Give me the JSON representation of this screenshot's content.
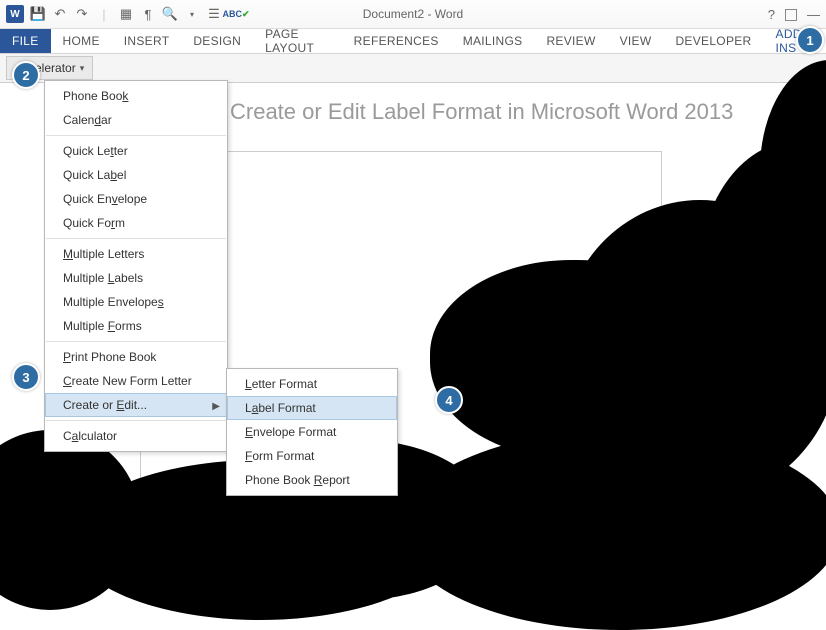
{
  "titlebar": {
    "app_icon_text": "W",
    "title": "Document2 - Word"
  },
  "tabs": {
    "file": "FILE",
    "home": "HOME",
    "insert": "INSERT",
    "design": "DESIGN",
    "page_layout": "PAGE LAYOUT",
    "references": "REFERENCES",
    "mailings": "MAILINGS",
    "review": "REVIEW",
    "view": "VIEW",
    "developer": "DEVELOPER",
    "addins": "ADD-INS"
  },
  "ribbon": {
    "accelerator_label": "Accelerator"
  },
  "doc": {
    "heading": "Create or Edit Label Format in Microsoft Word 2013"
  },
  "menu": {
    "phone_book": "Phone Book",
    "calendar": "Calendar",
    "quick_letter": "Quick Letter",
    "quick_label": "Quick Label",
    "quick_envelope": "Quick Envelope",
    "quick_form": "Quick Form",
    "multiple_letters": "Multiple Letters",
    "multiple_labels": "Multiple Labels",
    "multiple_envelopes": "Multiple Envelopes",
    "multiple_forms": "Multiple Forms",
    "print_phone_book": "Print Phone Book",
    "create_new_form_letter": "Create New Form Letter",
    "create_or_edit": "Create or Edit...",
    "calculator": "Calculator"
  },
  "submenu": {
    "letter_format": "Letter Format",
    "label_format": "Label Format",
    "envelope_format": "Envelope Format",
    "form_format": "Form Format",
    "phone_book_report": "Phone Book Report"
  },
  "badges": {
    "b1": "1",
    "b2": "2",
    "b3": "3",
    "b4": "4"
  }
}
